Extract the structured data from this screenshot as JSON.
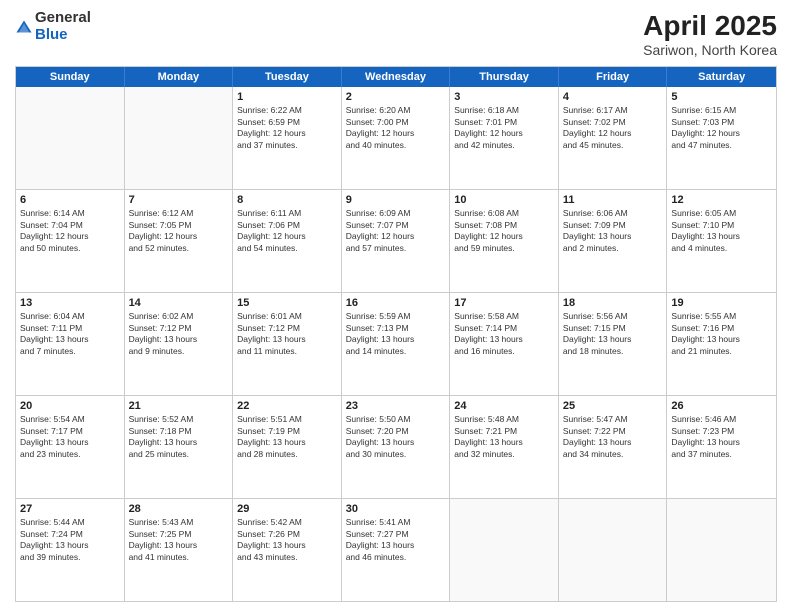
{
  "logo": {
    "general": "General",
    "blue": "Blue"
  },
  "title": {
    "month": "April 2025",
    "location": "Sariwon, North Korea"
  },
  "header": {
    "days": [
      "Sunday",
      "Monday",
      "Tuesday",
      "Wednesday",
      "Thursday",
      "Friday",
      "Saturday"
    ]
  },
  "weeks": [
    [
      {
        "day": "",
        "info": ""
      },
      {
        "day": "",
        "info": ""
      },
      {
        "day": "1",
        "info": "Sunrise: 6:22 AM\nSunset: 6:59 PM\nDaylight: 12 hours\nand 37 minutes."
      },
      {
        "day": "2",
        "info": "Sunrise: 6:20 AM\nSunset: 7:00 PM\nDaylight: 12 hours\nand 40 minutes."
      },
      {
        "day": "3",
        "info": "Sunrise: 6:18 AM\nSunset: 7:01 PM\nDaylight: 12 hours\nand 42 minutes."
      },
      {
        "day": "4",
        "info": "Sunrise: 6:17 AM\nSunset: 7:02 PM\nDaylight: 12 hours\nand 45 minutes."
      },
      {
        "day": "5",
        "info": "Sunrise: 6:15 AM\nSunset: 7:03 PM\nDaylight: 12 hours\nand 47 minutes."
      }
    ],
    [
      {
        "day": "6",
        "info": "Sunrise: 6:14 AM\nSunset: 7:04 PM\nDaylight: 12 hours\nand 50 minutes."
      },
      {
        "day": "7",
        "info": "Sunrise: 6:12 AM\nSunset: 7:05 PM\nDaylight: 12 hours\nand 52 minutes."
      },
      {
        "day": "8",
        "info": "Sunrise: 6:11 AM\nSunset: 7:06 PM\nDaylight: 12 hours\nand 54 minutes."
      },
      {
        "day": "9",
        "info": "Sunrise: 6:09 AM\nSunset: 7:07 PM\nDaylight: 12 hours\nand 57 minutes."
      },
      {
        "day": "10",
        "info": "Sunrise: 6:08 AM\nSunset: 7:08 PM\nDaylight: 12 hours\nand 59 minutes."
      },
      {
        "day": "11",
        "info": "Sunrise: 6:06 AM\nSunset: 7:09 PM\nDaylight: 13 hours\nand 2 minutes."
      },
      {
        "day": "12",
        "info": "Sunrise: 6:05 AM\nSunset: 7:10 PM\nDaylight: 13 hours\nand 4 minutes."
      }
    ],
    [
      {
        "day": "13",
        "info": "Sunrise: 6:04 AM\nSunset: 7:11 PM\nDaylight: 13 hours\nand 7 minutes."
      },
      {
        "day": "14",
        "info": "Sunrise: 6:02 AM\nSunset: 7:12 PM\nDaylight: 13 hours\nand 9 minutes."
      },
      {
        "day": "15",
        "info": "Sunrise: 6:01 AM\nSunset: 7:12 PM\nDaylight: 13 hours\nand 11 minutes."
      },
      {
        "day": "16",
        "info": "Sunrise: 5:59 AM\nSunset: 7:13 PM\nDaylight: 13 hours\nand 14 minutes."
      },
      {
        "day": "17",
        "info": "Sunrise: 5:58 AM\nSunset: 7:14 PM\nDaylight: 13 hours\nand 16 minutes."
      },
      {
        "day": "18",
        "info": "Sunrise: 5:56 AM\nSunset: 7:15 PM\nDaylight: 13 hours\nand 18 minutes."
      },
      {
        "day": "19",
        "info": "Sunrise: 5:55 AM\nSunset: 7:16 PM\nDaylight: 13 hours\nand 21 minutes."
      }
    ],
    [
      {
        "day": "20",
        "info": "Sunrise: 5:54 AM\nSunset: 7:17 PM\nDaylight: 13 hours\nand 23 minutes."
      },
      {
        "day": "21",
        "info": "Sunrise: 5:52 AM\nSunset: 7:18 PM\nDaylight: 13 hours\nand 25 minutes."
      },
      {
        "day": "22",
        "info": "Sunrise: 5:51 AM\nSunset: 7:19 PM\nDaylight: 13 hours\nand 28 minutes."
      },
      {
        "day": "23",
        "info": "Sunrise: 5:50 AM\nSunset: 7:20 PM\nDaylight: 13 hours\nand 30 minutes."
      },
      {
        "day": "24",
        "info": "Sunrise: 5:48 AM\nSunset: 7:21 PM\nDaylight: 13 hours\nand 32 minutes."
      },
      {
        "day": "25",
        "info": "Sunrise: 5:47 AM\nSunset: 7:22 PM\nDaylight: 13 hours\nand 34 minutes."
      },
      {
        "day": "26",
        "info": "Sunrise: 5:46 AM\nSunset: 7:23 PM\nDaylight: 13 hours\nand 37 minutes."
      }
    ],
    [
      {
        "day": "27",
        "info": "Sunrise: 5:44 AM\nSunset: 7:24 PM\nDaylight: 13 hours\nand 39 minutes."
      },
      {
        "day": "28",
        "info": "Sunrise: 5:43 AM\nSunset: 7:25 PM\nDaylight: 13 hours\nand 41 minutes."
      },
      {
        "day": "29",
        "info": "Sunrise: 5:42 AM\nSunset: 7:26 PM\nDaylight: 13 hours\nand 43 minutes."
      },
      {
        "day": "30",
        "info": "Sunrise: 5:41 AM\nSunset: 7:27 PM\nDaylight: 13 hours\nand 46 minutes."
      },
      {
        "day": "",
        "info": ""
      },
      {
        "day": "",
        "info": ""
      },
      {
        "day": "",
        "info": ""
      }
    ]
  ]
}
